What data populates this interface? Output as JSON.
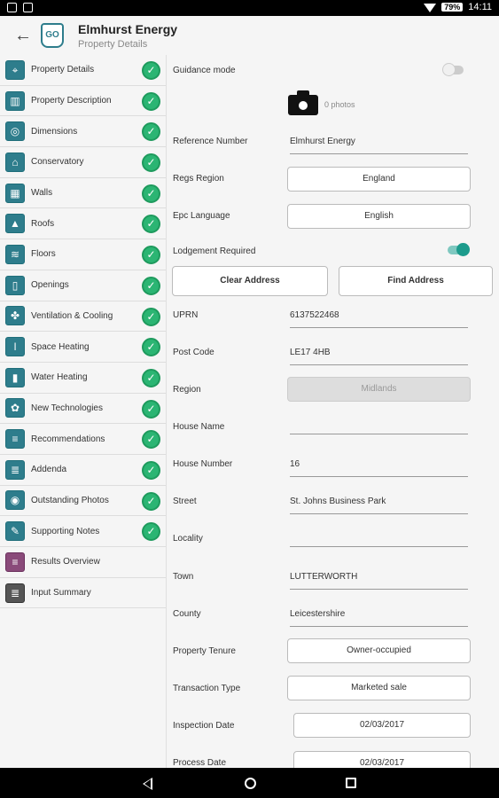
{
  "status_bar": {
    "battery": "79%",
    "time": "14:11"
  },
  "header": {
    "title": "Elmhurst Energy",
    "subtitle": "Property Details",
    "logo_text": "GO"
  },
  "sidebar": {
    "items": [
      {
        "label": "Property Details",
        "icon": "location-pin-icon",
        "complete": true
      },
      {
        "label": "Property Description",
        "icon": "building-description-icon",
        "complete": true
      },
      {
        "label": "Dimensions",
        "icon": "measure-tape-icon",
        "complete": true
      },
      {
        "label": "Conservatory",
        "icon": "conservatory-icon",
        "complete": true
      },
      {
        "label": "Walls",
        "icon": "brick-wall-icon",
        "complete": true
      },
      {
        "label": "Roofs",
        "icon": "roof-icon",
        "complete": true
      },
      {
        "label": "Floors",
        "icon": "floor-layers-icon",
        "complete": true
      },
      {
        "label": "Openings",
        "icon": "door-icon",
        "complete": true
      },
      {
        "label": "Ventilation & Cooling",
        "icon": "fan-icon",
        "complete": true
      },
      {
        "label": "Space Heating",
        "icon": "thermometer-icon",
        "complete": true
      },
      {
        "label": "Water Heating",
        "icon": "water-cylinder-icon",
        "complete": true
      },
      {
        "label": "New Technologies",
        "icon": "technology-icon",
        "complete": true
      },
      {
        "label": "Recommendations",
        "icon": "recommendations-document-icon",
        "complete": true
      },
      {
        "label": "Addenda",
        "icon": "addenda-document-icon",
        "complete": true
      },
      {
        "label": "Outstanding Photos",
        "icon": "camera-icon",
        "complete": true
      },
      {
        "label": "Supporting Notes",
        "icon": "notes-icon",
        "complete": true
      },
      {
        "label": "Results Overview",
        "icon": "results-icon",
        "complete": false
      },
      {
        "label": "Input Summary",
        "icon": "summary-icon",
        "complete": false
      }
    ]
  },
  "form": {
    "guidance_mode_label": "Guidance mode",
    "photos_count": "0 photos",
    "reference_number_label": "Reference Number",
    "reference_number_value": "Elmhurst Energy",
    "regs_region_label": "Regs Region",
    "regs_region_value": "England",
    "epc_language_label": "Epc Language",
    "epc_language_value": "English",
    "lodgement_required_label": "Lodgement Required",
    "clear_address_label": "Clear Address",
    "find_address_label": "Find Address",
    "uprn_label": "UPRN",
    "uprn_value": "6137522468",
    "post_code_label": "Post Code",
    "post_code_value": "LE17 4HB",
    "region_label": "Region",
    "region_value": "Midlands",
    "house_name_label": "House Name",
    "house_name_value": "",
    "house_number_label": "House Number",
    "house_number_value": "16",
    "street_label": "Street",
    "street_value": "St. Johns Business Park",
    "locality_label": "Locality",
    "locality_value": "",
    "town_label": "Town",
    "town_value": "LUTTERWORTH",
    "county_label": "County",
    "county_value": "Leicestershire",
    "property_tenure_label": "Property Tenure",
    "property_tenure_value": "Owner-occupied",
    "transaction_type_label": "Transaction Type",
    "transaction_type_value": "Marketed sale",
    "inspection_date_label": "Inspection Date",
    "inspection_date_value": "02/03/2017",
    "process_date_label": "Process Date",
    "process_date_value": "02/03/2017"
  }
}
